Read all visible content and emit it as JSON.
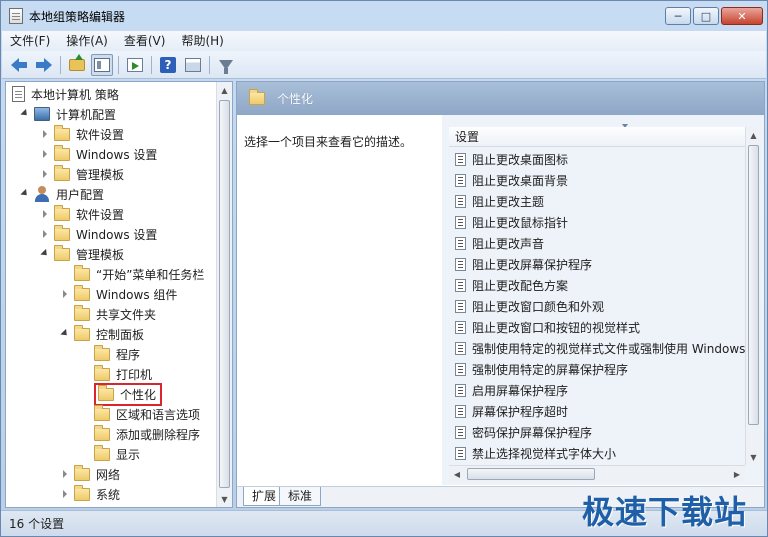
{
  "window": {
    "title": "本地组策略编辑器"
  },
  "menu": [
    "文件(F)",
    "操作(A)",
    "查看(V)",
    "帮助(H)"
  ],
  "toolbar": {
    "icons": [
      "back-arrow-icon",
      "forward-arrow-icon",
      "up-folder-icon",
      "show-hide-tree-icon",
      "export-list-icon",
      "help-icon",
      "properties-icon",
      "filter-icon"
    ]
  },
  "tree": {
    "items": [
      {
        "label": "本地计算机 策略",
        "level": 0,
        "icon": "doc",
        "twisty": "none"
      },
      {
        "label": "计算机配置",
        "level": 1,
        "icon": "pc",
        "twisty": "open"
      },
      {
        "label": "软件设置",
        "level": 2,
        "icon": "folder",
        "twisty": "closed"
      },
      {
        "label": "Windows 设置",
        "level": 2,
        "icon": "folder",
        "twisty": "closed"
      },
      {
        "label": "管理模板",
        "level": 2,
        "icon": "folder",
        "twisty": "closed"
      },
      {
        "label": "用户配置",
        "level": 1,
        "icon": "user",
        "twisty": "open"
      },
      {
        "label": "软件设置",
        "level": 2,
        "icon": "folder",
        "twisty": "closed"
      },
      {
        "label": "Windows 设置",
        "level": 2,
        "icon": "folder",
        "twisty": "closed"
      },
      {
        "label": "管理模板",
        "level": 2,
        "icon": "folder",
        "twisty": "open"
      },
      {
        "label": "“开始”菜单和任务栏",
        "level": 3,
        "icon": "folder",
        "twisty": "none"
      },
      {
        "label": "Windows 组件",
        "level": 3,
        "icon": "folder",
        "twisty": "closed"
      },
      {
        "label": "共享文件夹",
        "level": 3,
        "icon": "folder",
        "twisty": "none"
      },
      {
        "label": "控制面板",
        "level": 3,
        "icon": "folder",
        "twisty": "open"
      },
      {
        "label": "程序",
        "level": 4,
        "icon": "folder",
        "twisty": "none"
      },
      {
        "label": "打印机",
        "level": 4,
        "icon": "folder",
        "twisty": "none"
      },
      {
        "label": "个性化",
        "level": 4,
        "icon": "folder",
        "twisty": "none",
        "selected": true
      },
      {
        "label": "区域和语言选项",
        "level": 4,
        "icon": "folder",
        "twisty": "none"
      },
      {
        "label": "添加或删除程序",
        "level": 4,
        "icon": "folder",
        "twisty": "none"
      },
      {
        "label": "显示",
        "level": 4,
        "icon": "folder",
        "twisty": "none"
      },
      {
        "label": "网络",
        "level": 3,
        "icon": "folder",
        "twisty": "closed"
      },
      {
        "label": "系统",
        "level": 3,
        "icon": "folder",
        "twisty": "closed"
      }
    ]
  },
  "content": {
    "header_title": "个性化",
    "description": "选择一个项目来查看它的描述。",
    "column_header": "设置",
    "settings": [
      "阻止更改桌面图标",
      "阻止更改桌面背景",
      "阻止更改主题",
      "阻止更改鼠标指针",
      "阻止更改声音",
      "阻止更改屏幕保护程序",
      "阻止更改配色方案",
      "阻止更改窗口颜色和外观",
      "阻止更改窗口和按钮的视觉样式",
      "强制使用特定的视觉样式文件或强制使用 Windows",
      "强制使用特定的屏幕保护程序",
      "启用屏幕保护程序",
      "屏幕保护程序超时",
      "密码保护屏幕保护程序",
      "禁止选择视觉样式字体大小"
    ],
    "tabs": [
      "扩展",
      "标准"
    ]
  },
  "status": {
    "text": "16 个设置"
  },
  "watermark": "极速下载站",
  "colors": {
    "selection_highlight": "#d9262c",
    "header_bar": "#8ea7c6"
  }
}
